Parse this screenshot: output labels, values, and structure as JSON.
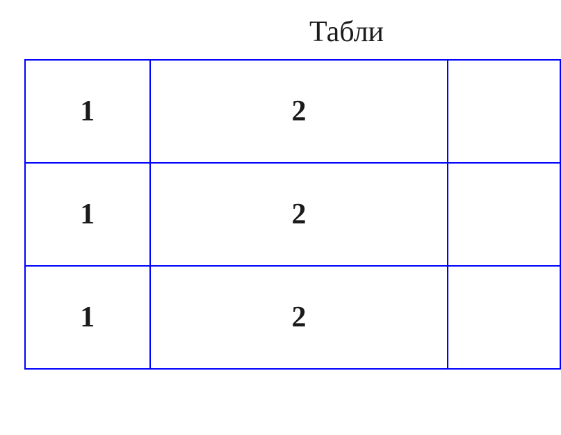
{
  "title": "Табли",
  "table": {
    "rows": [
      {
        "cells": [
          "1",
          "2",
          ""
        ]
      },
      {
        "cells": [
          "1",
          "2",
          ""
        ]
      },
      {
        "cells": [
          "1",
          "2",
          ""
        ]
      }
    ]
  }
}
